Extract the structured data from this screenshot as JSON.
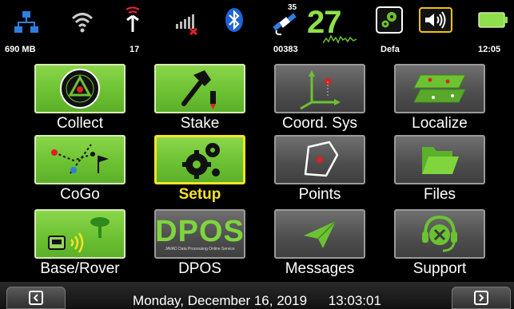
{
  "status_bar": {
    "memory": "690 MB",
    "signal_count": "17",
    "satellites_top": "35",
    "satellites_main": "27",
    "sat_counter": "00383",
    "profile": "Defa",
    "time": "12:05",
    "icons": [
      "network-icon",
      "wifi-icon",
      "radio-antenna-icon",
      "cellular-no-signal-icon",
      "bluetooth-icon",
      "satellite-icon",
      "gear-profile-icon",
      "speaker-icon",
      "battery-icon"
    ]
  },
  "tiles": [
    {
      "label": "Collect",
      "icon": "collect-target-icon",
      "style": "green"
    },
    {
      "label": "Stake",
      "icon": "hammer-stake-icon",
      "style": "green"
    },
    {
      "label": "Coord. Sys",
      "icon": "axes-icon",
      "style": "gray"
    },
    {
      "label": "Localize",
      "icon": "localize-planes-icon",
      "style": "green"
    },
    {
      "label": "CoGo",
      "icon": "cogo-icon",
      "style": "green"
    },
    {
      "label": "Setup",
      "icon": "gears-icon",
      "style": "green",
      "selected": true
    },
    {
      "label": "Points",
      "icon": "points-polygon-icon",
      "style": "gray"
    },
    {
      "label": "Files",
      "icon": "folder-icon",
      "style": "gray"
    },
    {
      "label": "Base/Rover",
      "icon": "base-rover-icon",
      "style": "green"
    },
    {
      "label": "DPOS",
      "icon": "dpos-logo-icon",
      "style": "gray",
      "logo_text": "DPOS",
      "logo_subtext": "JAVAD Data Processing Online Service"
    },
    {
      "label": "Messages",
      "icon": "paper-plane-icon",
      "style": "gray"
    },
    {
      "label": "Support",
      "icon": "support-headset-icon",
      "style": "gray"
    }
  ],
  "bottom_bar": {
    "date": "Monday, December 16, 2019",
    "time": "13:03:01"
  },
  "colors": {
    "tile_green": "#6cc232",
    "tile_gray": "#4d4d4d",
    "selected_border": "#f4e22a",
    "battery": "#8ee04a"
  }
}
